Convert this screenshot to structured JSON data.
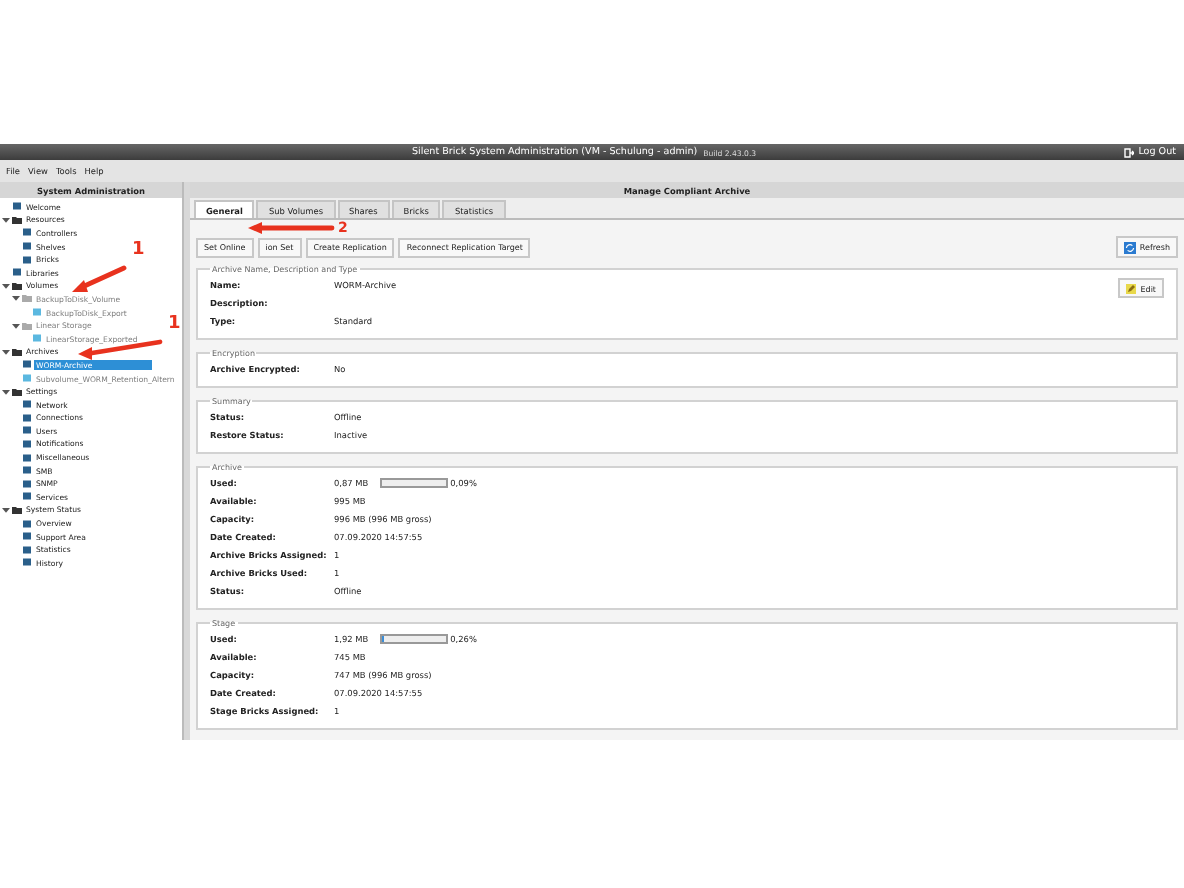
{
  "window": {
    "title": "Silent Brick System Administration (VM - Schulung - admin)",
    "build": "Build 2.43.0.3",
    "logout": "Log Out"
  },
  "menu": [
    "File",
    "View",
    "Tools",
    "Help"
  ],
  "sidebar": {
    "title": "System Administration",
    "items": [
      {
        "label": "Welcome",
        "selected": false,
        "disabled": false
      },
      {
        "label": "Resources",
        "expanded": true,
        "selected": false,
        "disabled": false,
        "children": [
          {
            "label": "Controllers",
            "selected": false,
            "disabled": false
          },
          {
            "label": "Shelves",
            "selected": false,
            "disabled": false
          },
          {
            "label": "Bricks",
            "selected": false,
            "disabled": false
          }
        ]
      },
      {
        "label": "Libraries",
        "selected": false,
        "disabled": false
      },
      {
        "label": "Volumes",
        "expanded": true,
        "selected": false,
        "disabled": false,
        "children": [
          {
            "label": "BackupToDisk_Volume",
            "expanded": true,
            "selected": false,
            "disabled": true,
            "children": [
              {
                "label": "BackupToDisk_Export",
                "selected": false,
                "disabled": true
              }
            ]
          },
          {
            "label": "Linear Storage",
            "expanded": true,
            "selected": false,
            "disabled": true,
            "children": [
              {
                "label": "LinearStorage_Exported",
                "selected": false,
                "disabled": true
              }
            ]
          }
        ]
      },
      {
        "label": "Archives",
        "expanded": true,
        "selected": false,
        "disabled": false,
        "children": [
          {
            "label": "WORM-Archive",
            "selected": true,
            "disabled": false
          },
          {
            "label": "Subvolume_WORM_Retention_Altern",
            "selected": false,
            "disabled": true
          }
        ]
      },
      {
        "label": "Settings",
        "expanded": true,
        "selected": false,
        "disabled": false,
        "children": [
          {
            "label": "Network",
            "selected": false,
            "disabled": false
          },
          {
            "label": "Connections",
            "selected": false,
            "disabled": false
          },
          {
            "label": "Users",
            "selected": false,
            "disabled": false
          },
          {
            "label": "Notifications",
            "selected": false,
            "disabled": false
          },
          {
            "label": "Miscellaneous",
            "selected": false,
            "disabled": false
          },
          {
            "label": "SMB",
            "selected": false,
            "disabled": false
          },
          {
            "label": "SNMP",
            "selected": false,
            "disabled": false
          },
          {
            "label": "Services",
            "selected": false,
            "disabled": false
          }
        ]
      },
      {
        "label": "System Status",
        "expanded": true,
        "selected": false,
        "disabled": false,
        "children": [
          {
            "label": "Overview",
            "selected": false,
            "disabled": false
          },
          {
            "label": "Support Area",
            "selected": false,
            "disabled": false
          },
          {
            "label": "Statistics",
            "selected": false,
            "disabled": false
          },
          {
            "label": "History",
            "selected": false,
            "disabled": false
          }
        ]
      }
    ]
  },
  "main": {
    "title": "Manage Compliant Archive",
    "tabs": [
      {
        "label": "General",
        "selected": true
      },
      {
        "label": "Sub Volumes",
        "selected": false
      },
      {
        "label": "Shares",
        "selected": false
      },
      {
        "label": "Bricks",
        "selected": false
      },
      {
        "label": "Statistics",
        "selected": false
      }
    ],
    "toolbar": [
      "Set Online",
      "ion Set",
      "Create Replication",
      "Reconnect Replication Target"
    ],
    "refresh": "Refresh",
    "sections": [
      {
        "title": "Archive Name, Description and Type",
        "edit": "Edit",
        "fields": [
          {
            "label": "Name:",
            "value": "WORM-Archive"
          },
          {
            "label": "Description:"
          },
          {
            "label": "Type:",
            "value": "Standard"
          }
        ]
      },
      {
        "title": "Encryption",
        "fields": [
          {
            "label": "Archive Encrypted:",
            "value": "No"
          }
        ]
      },
      {
        "title": "Summary",
        "fields": [
          {
            "label": "Status:",
            "value": "Offline"
          },
          {
            "label": "Restore Status:",
            "value": "Inactive"
          }
        ]
      },
      {
        "title": "Archive",
        "fields": [
          {
            "label": "Used:",
            "value": "0,87 MB",
            "level": 0.0009,
            "reading": "0,09%"
          },
          {
            "label": "Available:",
            "value": "995 MB"
          },
          {
            "label": "Capacity:",
            "value": "996 MB (996 MB gross)"
          },
          {
            "label": "Date Created:",
            "value": "07.09.2020 14:57:55"
          },
          {
            "label": "Archive Bricks Assigned:",
            "value": "1"
          },
          {
            "label": "Archive Bricks Used:",
            "value": "1"
          },
          {
            "label": "Status:",
            "value": "Offline"
          }
        ]
      },
      {
        "title": "Stage",
        "fields": [
          {
            "label": "Used:",
            "value": "1,92 MB",
            "level": 0.0026,
            "reading": "0,26%"
          },
          {
            "label": "Available:",
            "value": "745 MB"
          },
          {
            "label": "Capacity:",
            "value": "747 MB (996 MB gross)"
          },
          {
            "label": "Date Created:",
            "value": "07.09.2020 14:57:55"
          },
          {
            "label": "Stage Bricks Assigned:",
            "value": "1"
          }
        ]
      }
    ]
  },
  "annotations": [
    "1",
    "1",
    "2"
  ]
}
